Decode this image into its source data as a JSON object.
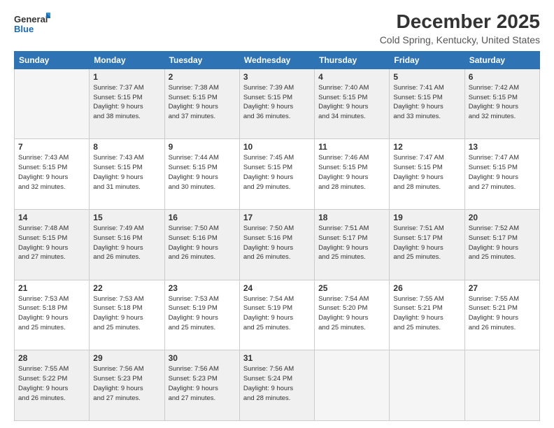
{
  "logo": {
    "line1": "General",
    "line2": "Blue"
  },
  "title": "December 2025",
  "subtitle": "Cold Spring, Kentucky, United States",
  "days_header": [
    "Sunday",
    "Monday",
    "Tuesday",
    "Wednesday",
    "Thursday",
    "Friday",
    "Saturday"
  ],
  "weeks": [
    [
      {
        "num": "",
        "info": "",
        "empty": true
      },
      {
        "num": "1",
        "info": "Sunrise: 7:37 AM\nSunset: 5:15 PM\nDaylight: 9 hours\nand 38 minutes."
      },
      {
        "num": "2",
        "info": "Sunrise: 7:38 AM\nSunset: 5:15 PM\nDaylight: 9 hours\nand 37 minutes."
      },
      {
        "num": "3",
        "info": "Sunrise: 7:39 AM\nSunset: 5:15 PM\nDaylight: 9 hours\nand 36 minutes."
      },
      {
        "num": "4",
        "info": "Sunrise: 7:40 AM\nSunset: 5:15 PM\nDaylight: 9 hours\nand 34 minutes."
      },
      {
        "num": "5",
        "info": "Sunrise: 7:41 AM\nSunset: 5:15 PM\nDaylight: 9 hours\nand 33 minutes."
      },
      {
        "num": "6",
        "info": "Sunrise: 7:42 AM\nSunset: 5:15 PM\nDaylight: 9 hours\nand 32 minutes."
      }
    ],
    [
      {
        "num": "7",
        "info": "Sunrise: 7:43 AM\nSunset: 5:15 PM\nDaylight: 9 hours\nand 32 minutes."
      },
      {
        "num": "8",
        "info": "Sunrise: 7:43 AM\nSunset: 5:15 PM\nDaylight: 9 hours\nand 31 minutes."
      },
      {
        "num": "9",
        "info": "Sunrise: 7:44 AM\nSunset: 5:15 PM\nDaylight: 9 hours\nand 30 minutes."
      },
      {
        "num": "10",
        "info": "Sunrise: 7:45 AM\nSunset: 5:15 PM\nDaylight: 9 hours\nand 29 minutes."
      },
      {
        "num": "11",
        "info": "Sunrise: 7:46 AM\nSunset: 5:15 PM\nDaylight: 9 hours\nand 28 minutes."
      },
      {
        "num": "12",
        "info": "Sunrise: 7:47 AM\nSunset: 5:15 PM\nDaylight: 9 hours\nand 28 minutes."
      },
      {
        "num": "13",
        "info": "Sunrise: 7:47 AM\nSunset: 5:15 PM\nDaylight: 9 hours\nand 27 minutes."
      }
    ],
    [
      {
        "num": "14",
        "info": "Sunrise: 7:48 AM\nSunset: 5:15 PM\nDaylight: 9 hours\nand 27 minutes."
      },
      {
        "num": "15",
        "info": "Sunrise: 7:49 AM\nSunset: 5:16 PM\nDaylight: 9 hours\nand 26 minutes."
      },
      {
        "num": "16",
        "info": "Sunrise: 7:50 AM\nSunset: 5:16 PM\nDaylight: 9 hours\nand 26 minutes."
      },
      {
        "num": "17",
        "info": "Sunrise: 7:50 AM\nSunset: 5:16 PM\nDaylight: 9 hours\nand 26 minutes."
      },
      {
        "num": "18",
        "info": "Sunrise: 7:51 AM\nSunset: 5:17 PM\nDaylight: 9 hours\nand 25 minutes."
      },
      {
        "num": "19",
        "info": "Sunrise: 7:51 AM\nSunset: 5:17 PM\nDaylight: 9 hours\nand 25 minutes."
      },
      {
        "num": "20",
        "info": "Sunrise: 7:52 AM\nSunset: 5:17 PM\nDaylight: 9 hours\nand 25 minutes."
      }
    ],
    [
      {
        "num": "21",
        "info": "Sunrise: 7:53 AM\nSunset: 5:18 PM\nDaylight: 9 hours\nand 25 minutes."
      },
      {
        "num": "22",
        "info": "Sunrise: 7:53 AM\nSunset: 5:18 PM\nDaylight: 9 hours\nand 25 minutes."
      },
      {
        "num": "23",
        "info": "Sunrise: 7:53 AM\nSunset: 5:19 PM\nDaylight: 9 hours\nand 25 minutes."
      },
      {
        "num": "24",
        "info": "Sunrise: 7:54 AM\nSunset: 5:19 PM\nDaylight: 9 hours\nand 25 minutes."
      },
      {
        "num": "25",
        "info": "Sunrise: 7:54 AM\nSunset: 5:20 PM\nDaylight: 9 hours\nand 25 minutes."
      },
      {
        "num": "26",
        "info": "Sunrise: 7:55 AM\nSunset: 5:21 PM\nDaylight: 9 hours\nand 25 minutes."
      },
      {
        "num": "27",
        "info": "Sunrise: 7:55 AM\nSunset: 5:21 PM\nDaylight: 9 hours\nand 26 minutes."
      }
    ],
    [
      {
        "num": "28",
        "info": "Sunrise: 7:55 AM\nSunset: 5:22 PM\nDaylight: 9 hours\nand 26 minutes."
      },
      {
        "num": "29",
        "info": "Sunrise: 7:56 AM\nSunset: 5:23 PM\nDaylight: 9 hours\nand 27 minutes."
      },
      {
        "num": "30",
        "info": "Sunrise: 7:56 AM\nSunset: 5:23 PM\nDaylight: 9 hours\nand 27 minutes."
      },
      {
        "num": "31",
        "info": "Sunrise: 7:56 AM\nSunset: 5:24 PM\nDaylight: 9 hours\nand 28 minutes."
      },
      {
        "num": "",
        "info": "",
        "empty": true
      },
      {
        "num": "",
        "info": "",
        "empty": true
      },
      {
        "num": "",
        "info": "",
        "empty": true
      }
    ]
  ]
}
